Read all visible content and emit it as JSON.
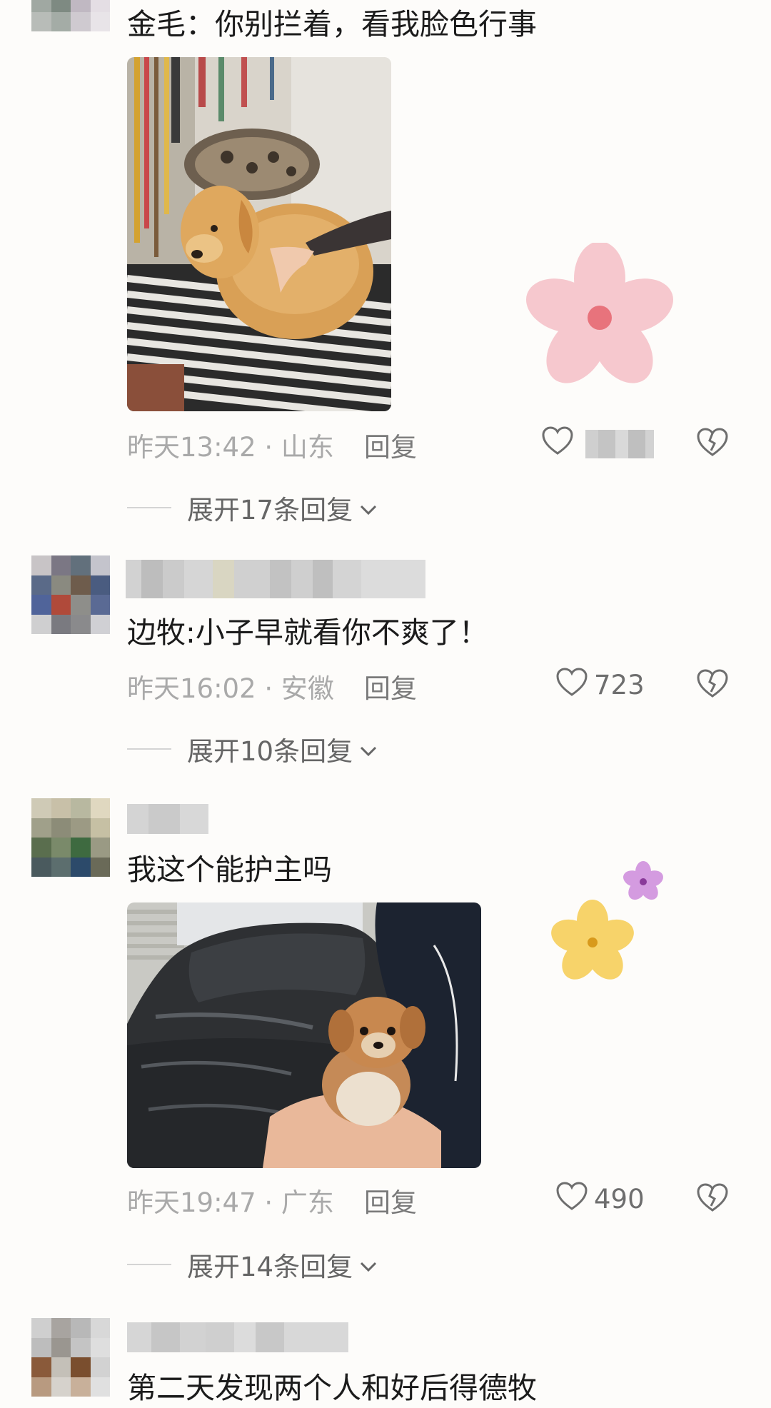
{
  "comments": [
    {
      "text": "金毛：你别拦着，看我脸色行事",
      "time": "昨天13:42 · 山东",
      "reply_label": "回复",
      "like_count": "",
      "expand_label": "展开17条回复"
    },
    {
      "text": "边牧:小子早就看你不爽了！",
      "time": "昨天16:02 · 安徽",
      "reply_label": "回复",
      "like_count": "723",
      "expand_label": "展开10条回复"
    },
    {
      "text": "我这个能护主吗",
      "time": "昨天19:47 · 广东",
      "reply_label": "回复",
      "like_count": "490",
      "expand_label": "展开14条回复"
    },
    {
      "text": "第二天发现两个人和好后得德牧"
    }
  ],
  "icons": {
    "like": "heart-outline-icon",
    "dislike": "broken-heart-icon",
    "expand": "chevron-down-icon"
  },
  "colors": {
    "meta_text": "#a9a9a9",
    "body_text": "#1b1b1b",
    "background": "#fdfcfa"
  }
}
